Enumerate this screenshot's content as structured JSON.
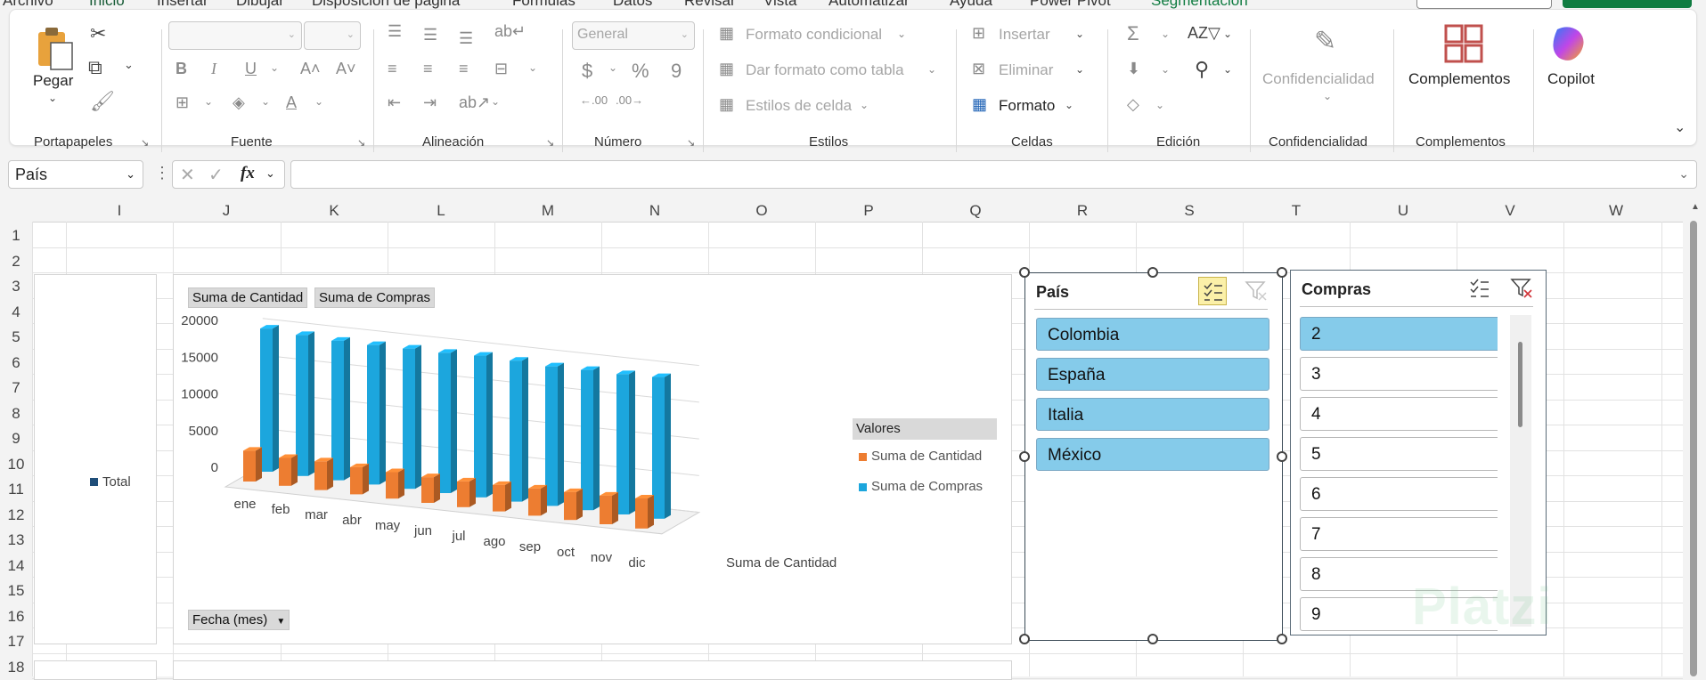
{
  "menu": {
    "items": [
      "Archivo",
      "Inicio",
      "Insertar",
      "Dibujar",
      "Disposición de página",
      "Fórmulas",
      "Datos",
      "Revisar",
      "Vista",
      "Automatizar",
      "Ayuda",
      "Power Pivot",
      "Segmentación"
    ]
  },
  "ribbon": {
    "clipboard": {
      "paste_label": "Pegar",
      "group_label": "Portapapeles"
    },
    "font": {
      "group_label": "Fuente"
    },
    "alignment": {
      "group_label": "Alineación"
    },
    "number": {
      "format_value": "General",
      "group_label": "Número"
    },
    "styles": {
      "conditional": "Formato condicional",
      "as_table": "Dar formato como tabla",
      "cell_styles": "Estilos de celda",
      "group_label": "Estilos"
    },
    "cells": {
      "insert": "Insertar",
      "delete": "Eliminar",
      "format": "Formato",
      "group_label": "Celdas"
    },
    "editing": {
      "group_label": "Edición"
    },
    "sensitivity": {
      "label": "Confidencialidad",
      "group_label": "Confidencialidad"
    },
    "addins": {
      "label": "Complementos",
      "group_label": "Complementos"
    },
    "copilot": {
      "label": "Copilot"
    }
  },
  "formula_bar": {
    "name_box": "País",
    "formula": ""
  },
  "columns": [
    "I",
    "J",
    "K",
    "L",
    "M",
    "N",
    "O",
    "P",
    "Q",
    "R",
    "S",
    "T",
    "U",
    "V",
    "W"
  ],
  "rows": [
    "1",
    "2",
    "3",
    "4",
    "5",
    "6",
    "7",
    "8",
    "9",
    "10",
    "11",
    "12",
    "13",
    "14",
    "15",
    "16",
    "17",
    "18"
  ],
  "left_chart": {
    "legend": "Total"
  },
  "main_chart": {
    "field_buttons": [
      "Suma de Cantidad",
      "Suma de Compras"
    ],
    "axis_field_button": "Fecha (mes)",
    "legend_title": "Valores",
    "depth_axis_label": "Suma de Cantidad"
  },
  "chart_data": {
    "type": "bar",
    "categories": [
      "ene",
      "feb",
      "mar",
      "abr",
      "may",
      "jun",
      "jul",
      "ago",
      "sep",
      "oct",
      "nov",
      "dic"
    ],
    "series": [
      {
        "name": "Suma de Cantidad",
        "color": "#ed7d31",
        "values": [
          4200,
          3800,
          3900,
          3700,
          3600,
          3500,
          3500,
          3600,
          3700,
          3800,
          3900,
          4100
        ]
      },
      {
        "name": "Suma de Compras",
        "color": "#1ca6dd",
        "values": [
          19500,
          19200,
          19000,
          19000,
          19100,
          19100,
          19300,
          19200,
          19000,
          19100,
          19100,
          19300
        ]
      }
    ],
    "yticks": [
      0,
      5000,
      10000,
      15000,
      20000
    ],
    "ylim": [
      0,
      20000
    ],
    "legend_position": "right"
  },
  "slicer_pais": {
    "title": "País",
    "items": [
      "Colombia",
      "España",
      "Italia",
      "México"
    ]
  },
  "slicer_compras": {
    "title": "Compras",
    "items": [
      "2",
      "3",
      "4",
      "5",
      "6",
      "7",
      "8",
      "9"
    ]
  },
  "watermark": "Platzi"
}
